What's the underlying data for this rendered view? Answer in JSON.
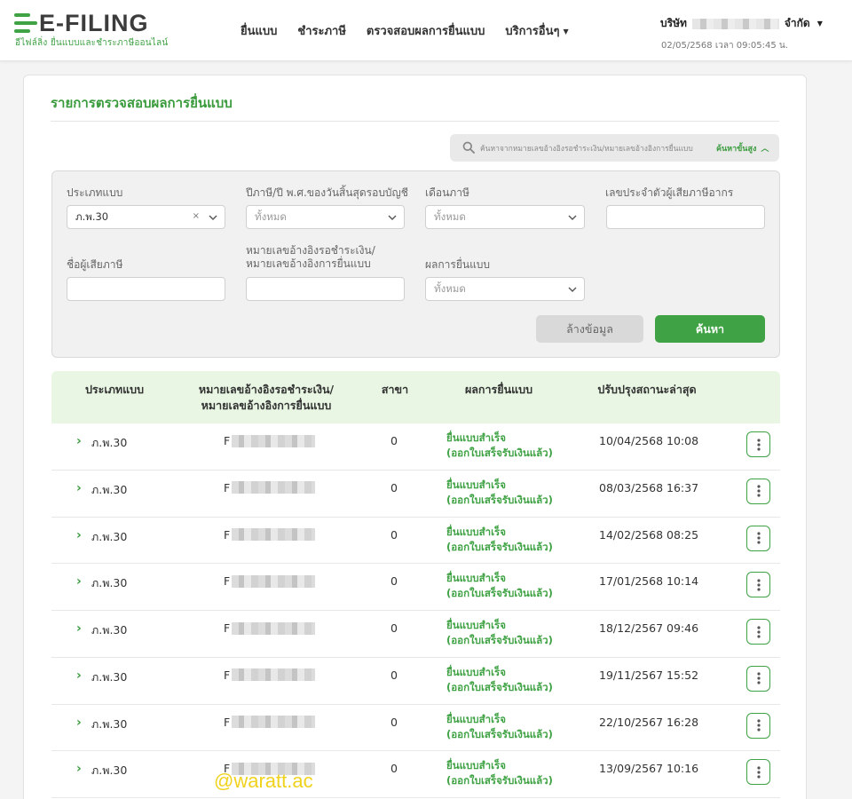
{
  "brand": {
    "logo_text": "E-FILING",
    "tagline": "อีไฟล์ลิ่ง ยื่นแบบและชำระภาษีออนไลน์",
    "accent_color": "#3fa244"
  },
  "nav": {
    "items": [
      {
        "label": "ยื่นแบบ"
      },
      {
        "label": "ชำระภาษี"
      },
      {
        "label": "ตรวจสอบผลการยื่นแบบ"
      },
      {
        "label": "บริการอื่นๆ"
      }
    ]
  },
  "user": {
    "company_prefix": "บริษัท",
    "company_suffix": "จำกัด",
    "datetime": "02/05/2568 เวลา 09:05:45 น."
  },
  "page": {
    "title": "รายการตรวจสอบผลการยื่นแบบ"
  },
  "search": {
    "placeholder": "ค้นหาจากหมายเลขอ้างอิงรอชำระเงิน/หมายเลขอ้างอิงการยื่นแบบ",
    "advanced_label": "ค้นหาขั้นสูง"
  },
  "filters": {
    "form_type": {
      "label": "ประเภทแบบ",
      "value": "ภ.พ.30"
    },
    "tax_year": {
      "label": "ปีภาษี/ปี พ.ศ.ของวันสิ้นสุดรอบบัญชี",
      "value": "ทั้งหมด"
    },
    "tax_month": {
      "label": "เดือนภาษี",
      "value": "ทั้งหมด"
    },
    "tax_id": {
      "label": "เลขประจำตัวผู้เสียภาษีอากร",
      "value": ""
    },
    "taxpayer_name": {
      "label": "ชื่อผู้เสียภาษี",
      "value": ""
    },
    "ref_no": {
      "label_line1": "หมายเลขอ้างอิงรอชำระเงิน/",
      "label_line2": "หมายเลขอ้างอิงการยื่นแบบ",
      "value": ""
    },
    "filing_result": {
      "label": "ผลการยื่นแบบ",
      "value": "ทั้งหมด"
    },
    "clear_button": "ล้างข้อมูล",
    "search_button": "ค้นหา"
  },
  "table": {
    "headers": {
      "form_type": "ประเภทแบบ",
      "ref_line1": "หมายเลขอ้างอิงรอชำระเงิน/",
      "ref_line2": "หมายเลขอ้างอิงการยื่นแบบ",
      "branch": "สาขา",
      "result": "ผลการยื่นแบบ",
      "updated": "ปรับปรุงสถานะล่าสุด"
    },
    "rows": [
      {
        "form_type": "ภ.พ.30",
        "ref_prefix": "F",
        "branch": "0",
        "result_line1": "ยื่นแบบสำเร็จ",
        "result_line2": "(ออกใบเสร็จรับเงินแล้ว)",
        "updated": "10/04/2568 10:08"
      },
      {
        "form_type": "ภ.พ.30",
        "ref_prefix": "F",
        "branch": "0",
        "result_line1": "ยื่นแบบสำเร็จ",
        "result_line2": "(ออกใบเสร็จรับเงินแล้ว)",
        "updated": "08/03/2568 16:37"
      },
      {
        "form_type": "ภ.พ.30",
        "ref_prefix": "F",
        "branch": "0",
        "result_line1": "ยื่นแบบสำเร็จ",
        "result_line2": "(ออกใบเสร็จรับเงินแล้ว)",
        "updated": "14/02/2568 08:25"
      },
      {
        "form_type": "ภ.พ.30",
        "ref_prefix": "F",
        "branch": "0",
        "result_line1": "ยื่นแบบสำเร็จ",
        "result_line2": "(ออกใบเสร็จรับเงินแล้ว)",
        "updated": "17/01/2568 10:14"
      },
      {
        "form_type": "ภ.พ.30",
        "ref_prefix": "F",
        "branch": "0",
        "result_line1": "ยื่นแบบสำเร็จ",
        "result_line2": "(ออกใบเสร็จรับเงินแล้ว)",
        "updated": "18/12/2567 09:46"
      },
      {
        "form_type": "ภ.พ.30",
        "ref_prefix": "F",
        "branch": "0",
        "result_line1": "ยื่นแบบสำเร็จ",
        "result_line2": "(ออกใบเสร็จรับเงินแล้ว)",
        "updated": "19/11/2567 15:52"
      },
      {
        "form_type": "ภ.พ.30",
        "ref_prefix": "F",
        "branch": "0",
        "result_line1": "ยื่นแบบสำเร็จ",
        "result_line2": "(ออกใบเสร็จรับเงินแล้ว)",
        "updated": "22/10/2567 16:28"
      },
      {
        "form_type": "ภ.พ.30",
        "ref_prefix": "F",
        "branch": "0",
        "result_line1": "ยื่นแบบสำเร็จ",
        "result_line2": "(ออกใบเสร็จรับเงินแล้ว)",
        "updated": "13/09/2567 10:16"
      }
    ]
  },
  "watermark": "@waratt.ac"
}
